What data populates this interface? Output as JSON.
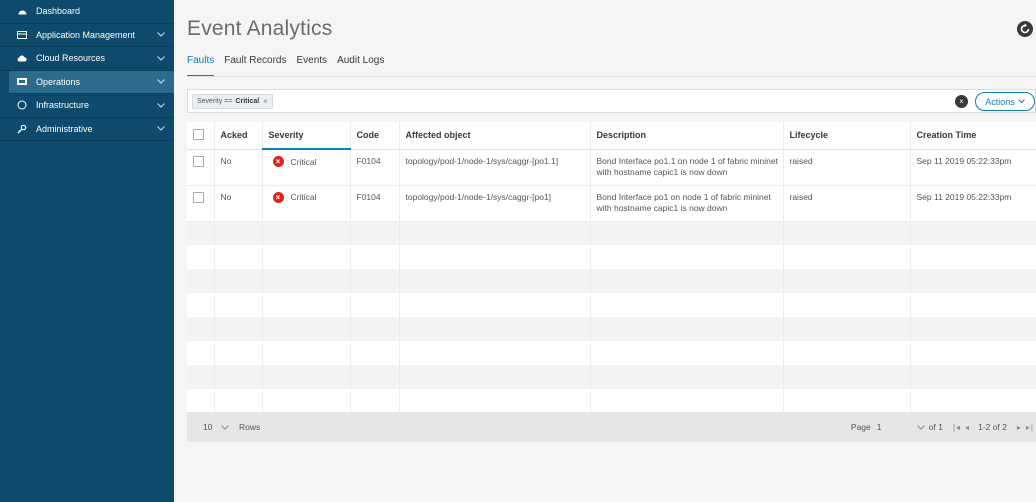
{
  "sidebar": {
    "items": [
      {
        "label": "Dashboard",
        "icon": "dashboard-icon",
        "has_chevron": false
      },
      {
        "label": "Application Management",
        "icon": "application-icon",
        "has_chevron": true
      },
      {
        "label": "Cloud Resources",
        "icon": "cloud-icon",
        "has_chevron": true
      },
      {
        "label": "Operations",
        "icon": "operations-icon",
        "has_chevron": true,
        "active": true
      },
      {
        "label": "Infrastructure",
        "icon": "infrastructure-icon",
        "has_chevron": true
      },
      {
        "label": "Administrative",
        "icon": "admin-wrench-icon",
        "has_chevron": true
      }
    ]
  },
  "header": {
    "title": "Event Analytics",
    "refresh_icon": "refresh-icon"
  },
  "tabs": [
    {
      "label": "Faults",
      "active": true
    },
    {
      "label": "Fault Records",
      "active": false
    },
    {
      "label": "Events",
      "active": false
    },
    {
      "label": "Audit Logs",
      "active": false
    }
  ],
  "filter": {
    "chip_key": "Severity ==",
    "chip_value": "Critical",
    "chip_remove": "×",
    "clear": "×",
    "actions_label": "Actions"
  },
  "table": {
    "columns": [
      "",
      "Acked",
      "Severity",
      "Code",
      "Affected object",
      "Description",
      "Lifecycle",
      "Creation Time"
    ],
    "rows": [
      {
        "acked": "No",
        "severity": "Critical",
        "code": "F0104",
        "affected_object": "topology/pod-1/node-1/sys/caggr-[po1.1]",
        "description": "Bond Interface po1.1 on node 1 of fabric mininet with hostname capic1 is now down",
        "lifecycle": "raised",
        "creation_time": "Sep 11 2019 05:22:33pm"
      },
      {
        "acked": "No",
        "severity": "Critical",
        "code": "F0104",
        "affected_object": "topology/pod-1/node-1/sys/caggr-[po1]",
        "description": "Bond Interface po1 on node 1 of fabric mininet with hostname capic1 is now down",
        "lifecycle": "raised",
        "creation_time": "Sep 11 2019 05:22:33pm"
      }
    ]
  },
  "pager": {
    "rows_value": "10",
    "rows_label": "Rows",
    "page_label": "Page",
    "page_value": "1",
    "of_label": "of 1",
    "range_label": "1-2 of 2"
  },
  "colors": {
    "sidebar": "#0d4a6b",
    "accent": "#0d7fb0",
    "critical": "#e2231a"
  }
}
